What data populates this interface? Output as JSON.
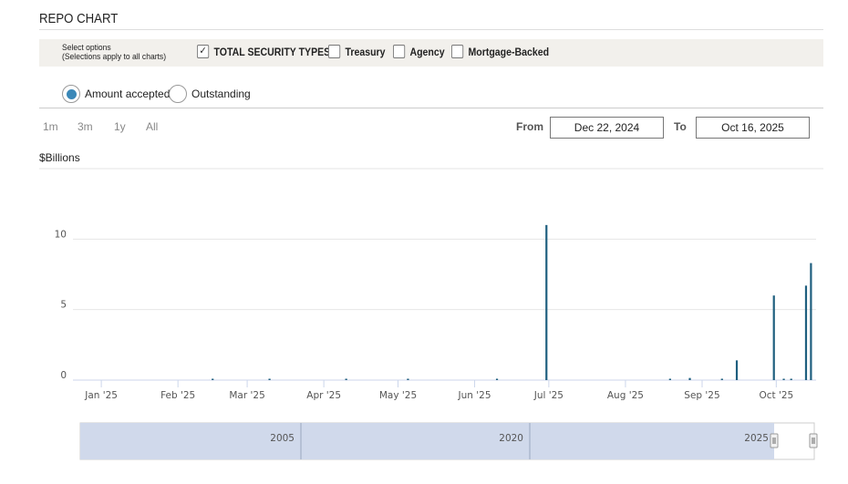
{
  "title": "REPO CHART",
  "options": {
    "label_line1": "Select options",
    "label_line2": "(Selections apply to all charts)",
    "checkboxes": [
      {
        "label": "TOTAL SECURITY TYPES",
        "checked": true
      },
      {
        "label": "Treasury",
        "checked": false
      },
      {
        "label": "Agency",
        "checked": false
      },
      {
        "label": "Mortgage-Backed",
        "checked": false
      }
    ],
    "check_glyph": "✓"
  },
  "radios": [
    {
      "label": "Amount accepted",
      "selected": true
    },
    {
      "label": "Outstanding",
      "selected": false
    }
  ],
  "range_buttons": [
    "1m",
    "3m",
    "1y",
    "All"
  ],
  "date_range": {
    "from_label": "From",
    "from": "Dec 22, 2024",
    "to_label": "To",
    "to": "Oct 16, 2025"
  },
  "chart_data": {
    "type": "bar",
    "title": "",
    "ylabel": "$Billions",
    "xlabel": "",
    "ylim": [
      0,
      15
    ],
    "yticks": [
      0,
      5,
      10
    ],
    "xrange": [
      "2024-12-22",
      "2025-10-16"
    ],
    "xticks": [
      {
        "date": "2025-01-01",
        "label": "Jan '25"
      },
      {
        "date": "2025-02-01",
        "label": "Feb '25"
      },
      {
        "date": "2025-03-01",
        "label": "Mar '25"
      },
      {
        "date": "2025-04-01",
        "label": "Apr '25"
      },
      {
        "date": "2025-05-01",
        "label": "May '25"
      },
      {
        "date": "2025-06-01",
        "label": "Jun '25"
      },
      {
        "date": "2025-07-01",
        "label": "Jul '25"
      },
      {
        "date": "2025-08-01",
        "label": "Aug '25"
      },
      {
        "date": "2025-09-01",
        "label": "Sep '25"
      },
      {
        "date": "2025-10-01",
        "label": "Oct '25"
      }
    ],
    "series": [
      {
        "name": "Amount accepted",
        "color": "#1f5f7f",
        "points": [
          {
            "date": "2025-02-15",
            "value": 0.05
          },
          {
            "date": "2025-03-10",
            "value": 0.05
          },
          {
            "date": "2025-04-10",
            "value": 0.05
          },
          {
            "date": "2025-05-05",
            "value": 0.05
          },
          {
            "date": "2025-06-10",
            "value": 0.05
          },
          {
            "date": "2025-06-30",
            "value": 11.0
          },
          {
            "date": "2025-08-19",
            "value": 0.05
          },
          {
            "date": "2025-08-27",
            "value": 0.15
          },
          {
            "date": "2025-09-09",
            "value": 0.05
          },
          {
            "date": "2025-09-15",
            "value": 1.4
          },
          {
            "date": "2025-09-30",
            "value": 6.0
          },
          {
            "date": "2025-10-04",
            "value": 0.05
          },
          {
            "date": "2025-10-07",
            "value": 0.05
          },
          {
            "date": "2025-10-13",
            "value": 6.7
          },
          {
            "date": "2025-10-15",
            "value": 8.3
          }
        ]
      }
    ],
    "navigator": {
      "labels": [
        "2005",
        "2020",
        "2025"
      ]
    }
  }
}
